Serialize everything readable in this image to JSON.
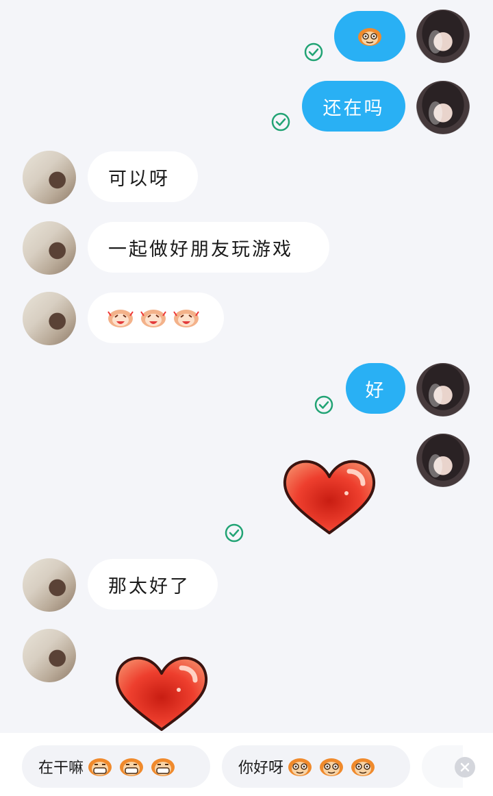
{
  "messages": [
    {
      "side": "me",
      "emoji": "monkey-face-emoji"
    },
    {
      "side": "me",
      "text": "还在吗"
    },
    {
      "side": "them",
      "text": "可以呀"
    },
    {
      "side": "them",
      "text": "一起做好朋友玩游戏"
    },
    {
      "side": "them",
      "emoji": "laughing-monkey-emoji x3"
    },
    {
      "side": "me",
      "text": "好"
    },
    {
      "side": "me",
      "sticker": "red-heart-sticker"
    },
    {
      "side": "them",
      "text": "那太好了"
    },
    {
      "side": "them",
      "sticker": "red-heart-sticker"
    }
  ],
  "quick_replies": [
    {
      "label": "在干嘛",
      "emoji": "grinning-monkey-emoji x3"
    },
    {
      "label": "你好呀",
      "emoji": "monkey-face-emoji x3"
    }
  ],
  "colors": {
    "background": "#f4f5f9",
    "my_bubble": "#29b0f4",
    "their_bubble": "#ffffff",
    "sent_check": "#21a374",
    "heart": "#ef3b2d"
  }
}
